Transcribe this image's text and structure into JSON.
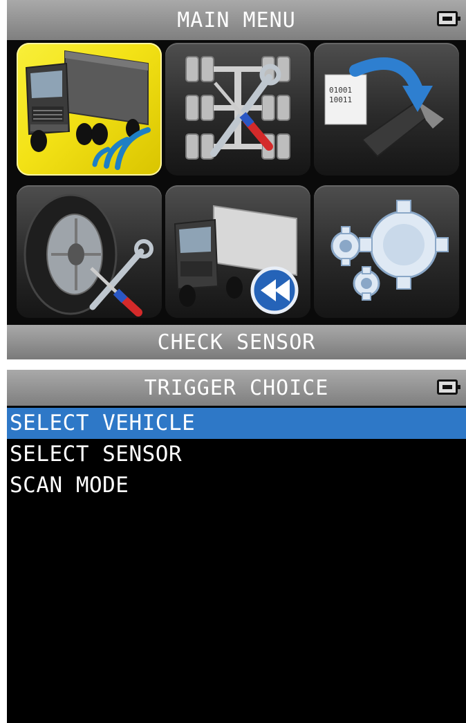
{
  "screen1": {
    "title": "MAIN MENU",
    "status_label": "CHECK SENSOR",
    "tiles": [
      {
        "icon": "truck-sensor-signal-icon",
        "selected": true
      },
      {
        "icon": "axle-service-tools-icon",
        "selected": false
      },
      {
        "icon": "sensor-programming-icon",
        "selected": false
      },
      {
        "icon": "tire-service-tools-icon",
        "selected": false
      },
      {
        "icon": "truck-rewind-icon",
        "selected": false
      },
      {
        "icon": "settings-gears-icon",
        "selected": false
      }
    ],
    "colors": {
      "selected_tile": "#f3e216",
      "header": "#8f8f8f"
    }
  },
  "screen2": {
    "title": "TRIGGER CHOICE",
    "items": [
      {
        "label": "SELECT VEHICLE",
        "selected": true
      },
      {
        "label": "SELECT SENSOR",
        "selected": false
      },
      {
        "label": "SCAN MODE",
        "selected": false
      }
    ],
    "colors": {
      "selection": "#2e78c7",
      "background": "#000000"
    }
  }
}
